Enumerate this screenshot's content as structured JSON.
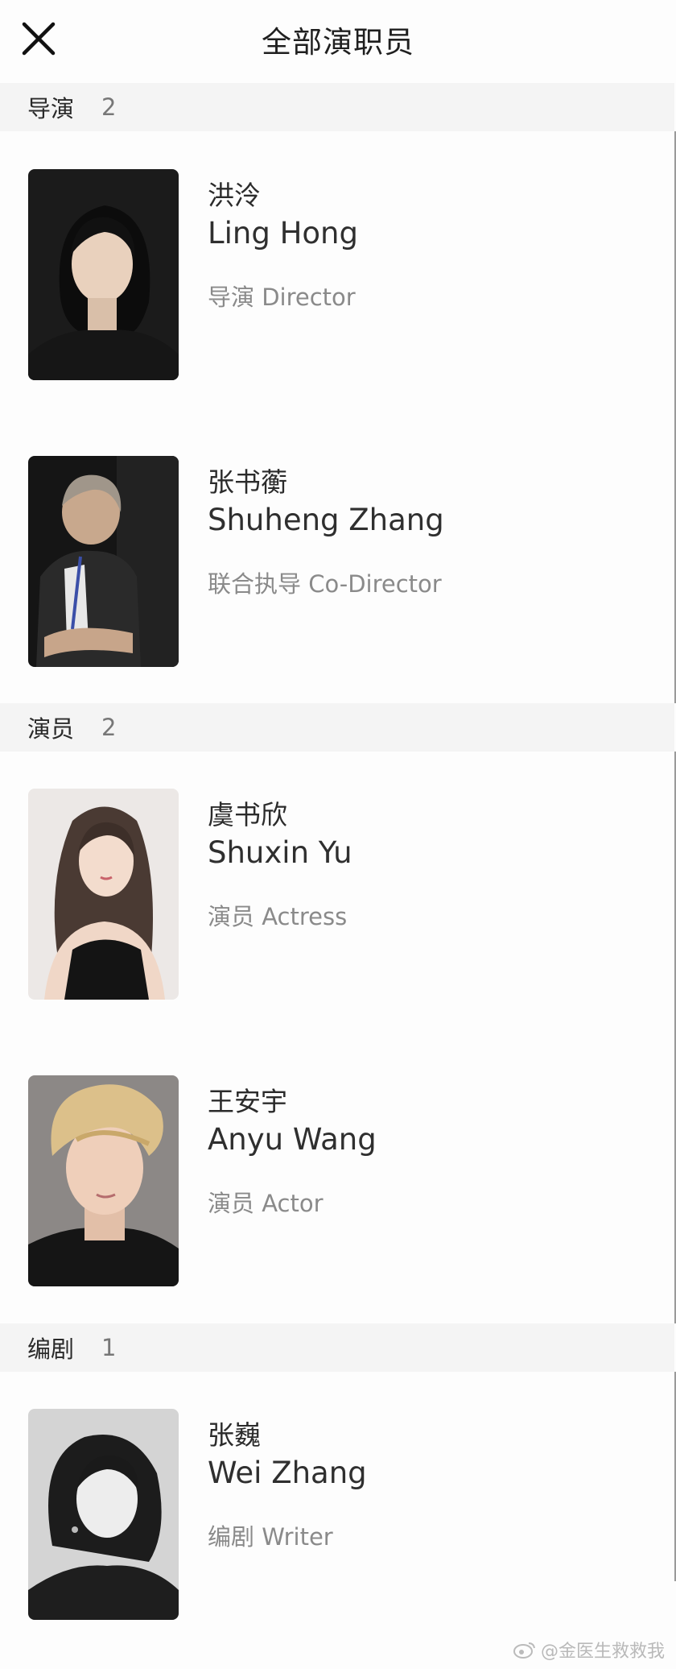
{
  "header": {
    "title": "全部演职员"
  },
  "sections": [
    {
      "name": "导演",
      "count": "2",
      "people": [
        {
          "cn": "洪泠",
          "en": "Ling Hong",
          "role": "导演 Director"
        },
        {
          "cn": "张书蘅",
          "en": "Shuheng Zhang",
          "role": "联合执导 Co-Director"
        }
      ]
    },
    {
      "name": "演员",
      "count": "2",
      "people": [
        {
          "cn": "虞书欣",
          "en": "Shuxin Yu",
          "role": "演员 Actress"
        },
        {
          "cn": "王安宇",
          "en": "Anyu Wang",
          "role": "演员 Actor"
        }
      ]
    },
    {
      "name": "编剧",
      "count": "1",
      "people": [
        {
          "cn": "张巍",
          "en": "Wei Zhang",
          "role": "编剧 Writer"
        }
      ]
    }
  ],
  "watermark": "@金医生救救我",
  "icons": {
    "close": "close-icon",
    "weibo": "weibo-icon"
  }
}
